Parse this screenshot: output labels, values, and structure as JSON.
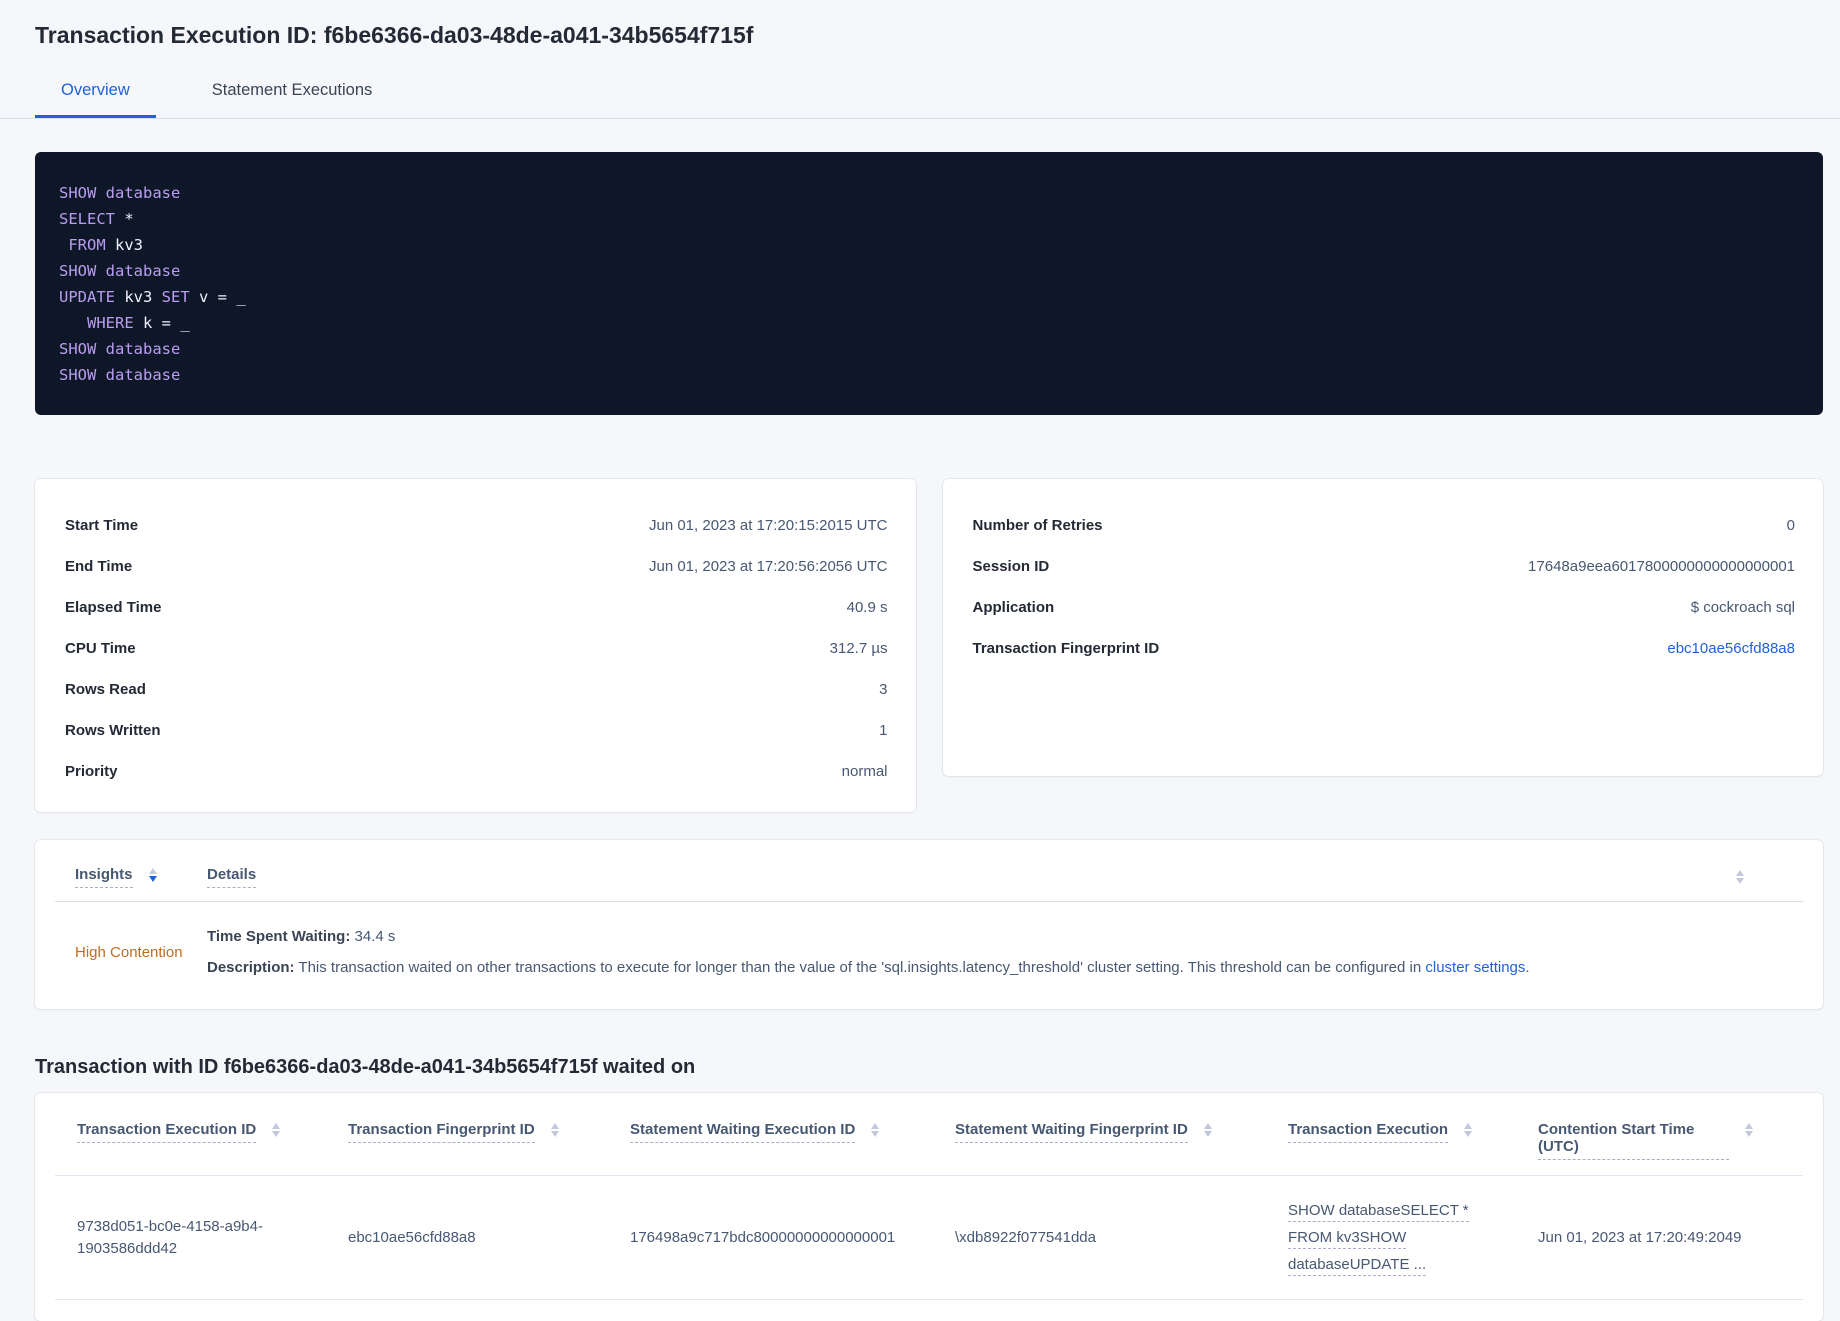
{
  "page": {
    "title": "Transaction Execution ID: f6be6366-da03-48de-a041-34b5654f715f"
  },
  "tabs": [
    {
      "label": "Overview",
      "active": true
    },
    {
      "label": "Statement Executions",
      "active": false
    }
  ],
  "colors": {
    "accent_blue": "#2161dd",
    "high_contention_orange": "#bf6c1e",
    "sql_keyword_lavender": "#bb9df0",
    "sql_box_background": "#0d1728"
  },
  "sql": {
    "lines": [
      [
        {
          "t": "SHOW database"
        }
      ],
      [
        {
          "t": "SELECT"
        },
        {
          "t": " *"
        }
      ],
      [
        {
          "t": " FROM"
        },
        {
          "t": " kv3"
        }
      ],
      [
        {
          "t": "SHOW database"
        }
      ],
      [
        {
          "t": "UPDATE"
        },
        {
          "t": " kv3 "
        },
        {
          "t": "SET"
        },
        {
          "t": " v = _"
        }
      ],
      [
        {
          "t": "   WHERE"
        },
        {
          "t": " k = _"
        }
      ],
      [
        {
          "t": "SHOW database"
        }
      ],
      [
        {
          "t": "SHOW database"
        }
      ]
    ]
  },
  "left_card": {
    "rows": [
      {
        "label": "Start Time",
        "value": "Jun 01, 2023 at 17:20:15:2015 UTC"
      },
      {
        "label": "End Time",
        "value": "Jun 01, 2023 at 17:20:56:2056 UTC"
      },
      {
        "label": "Elapsed Time",
        "value": "40.9 s"
      },
      {
        "label": "CPU Time",
        "value": "312.7 µs"
      },
      {
        "label": "Rows Read",
        "value": "3"
      },
      {
        "label": "Rows Written",
        "value": "1"
      },
      {
        "label": "Priority",
        "value": "normal"
      }
    ]
  },
  "right_card": {
    "rows": [
      {
        "label": "Number of Retries",
        "value": "0"
      },
      {
        "label": "Session ID",
        "value": "17648a9eea6017800000000000000001"
      },
      {
        "label": "Application",
        "value": "$ cockroach sql"
      },
      {
        "label": "Transaction Fingerprint ID",
        "value": "ebc10ae56cfd88a8"
      }
    ]
  },
  "insights": {
    "header": {
      "insights_label": "Insights",
      "details_label": "Details"
    },
    "row": {
      "insight": "High Contention",
      "waiting_label": "Time Spent Waiting:",
      "waiting_value": " 34.4 s",
      "description_label": "Description:",
      "description_text": " This transaction waited on other transactions to execute for longer than the value of the 'sql.insights.latency_threshold' cluster setting. This threshold can be configured in ",
      "description_link": "cluster settings",
      "description_end": "."
    }
  },
  "waited_on": {
    "heading": "Transaction with ID f6be6366-da03-48de-a041-34b5654f715f waited on",
    "columns": [
      "Transaction Execution ID",
      "Transaction Fingerprint ID",
      "Statement Waiting Execution ID",
      "Statement Waiting Fingerprint ID",
      "Transaction Execution",
      "Contention Start Time (UTC)"
    ],
    "row": {
      "transaction_execution_id": "9738d051-bc0e-4158-a9b4-1903586ddd42",
      "transaction_fingerprint_id": "ebc10ae56cfd88a8",
      "statement_waiting_execution_id": "176498a9c717bdc80000000000000001",
      "statement_waiting_fingerprint_id": "\\xdb8922f077541dda",
      "transaction_execution_lines": [
        "SHOW databaseSELECT *",
        "FROM kv3SHOW",
        "databaseUPDATE ..."
      ],
      "contention_start_time": "Jun 01, 2023 at 17:20:49:2049"
    }
  }
}
